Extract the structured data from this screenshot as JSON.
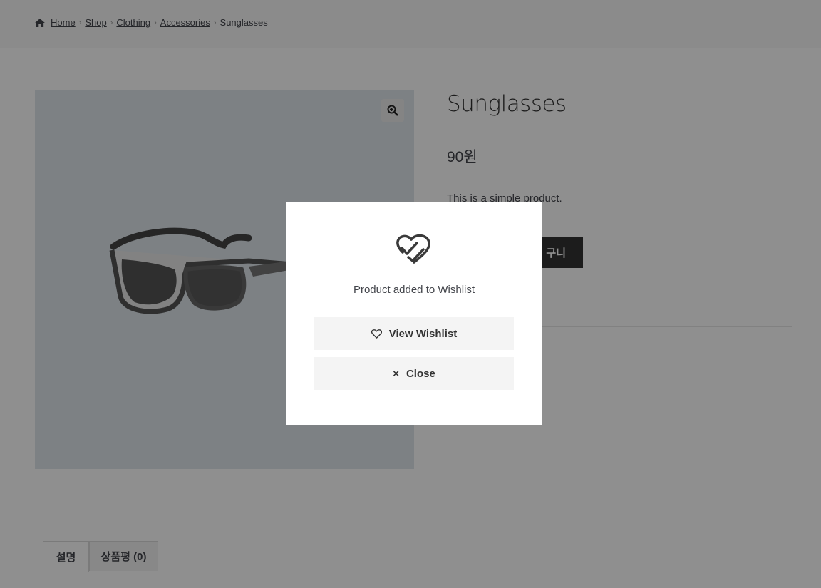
{
  "breadcrumb": {
    "items": [
      "Home",
      "Shop",
      "Clothing",
      "Accessories"
    ],
    "current": "Sunglasses",
    "separator": "›"
  },
  "product": {
    "title": "Sunglasses",
    "price": "90원",
    "description": "This is a simple product.",
    "add_to_cart_label": "구니"
  },
  "tabs": [
    {
      "label": "설명",
      "active": true
    },
    {
      "label": "상품평 (0)",
      "active": false
    }
  ],
  "modal": {
    "message": "Product added to Wishlist",
    "view_wishlist_label": "View Wishlist",
    "close_label": "Close",
    "close_glyph": "×"
  },
  "icons": {
    "home": "home-icon",
    "zoom": "zoom-in-icon",
    "wishlist_added": "heart-check-icon",
    "heart": "heart-outline-icon",
    "close": "close-icon"
  },
  "colors": {
    "overlay": "#000000",
    "button_dark": "#333333",
    "gallery_bg": "#dfe6ec"
  }
}
